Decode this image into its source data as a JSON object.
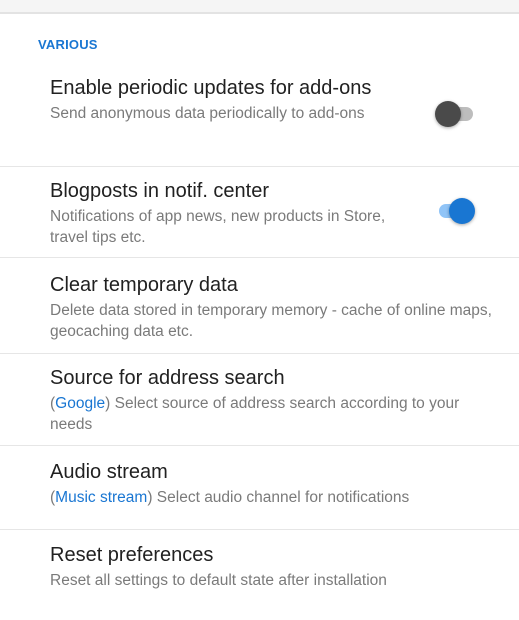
{
  "section": {
    "header": "VARIOUS"
  },
  "settings": [
    {
      "title": "Enable periodic updates for add-ons",
      "description": "Send anonymous data periodically to add-ons",
      "toggle": "off"
    },
    {
      "title": "Blogposts in notif. center",
      "description": "Notifications of app news, new products in Store, travel tips etc.",
      "toggle": "on"
    },
    {
      "title": "Clear temporary data",
      "description": "Delete data stored in temporary memory - cache of online maps, geocaching data etc."
    },
    {
      "title": "Source for address search",
      "value_open": "(",
      "value": "Google",
      "value_close": ")",
      "description": " Select source of address search according to your needs"
    },
    {
      "title": "Audio stream",
      "value_open": "(",
      "value": "Music stream",
      "value_close": ")",
      "description": " Select audio channel for notifications"
    },
    {
      "title": "Reset preferences",
      "description": "Reset all settings to default state after installation"
    }
  ],
  "colors": {
    "accent": "#1976d2",
    "switch_on_track": "#90c4f7",
    "switch_off_thumb": "#4a4a4a",
    "switch_off_track": "#bdbdbd"
  },
  "icons": {
    "toggle_off": "switch-off-icon",
    "toggle_on": "switch-on-icon"
  }
}
